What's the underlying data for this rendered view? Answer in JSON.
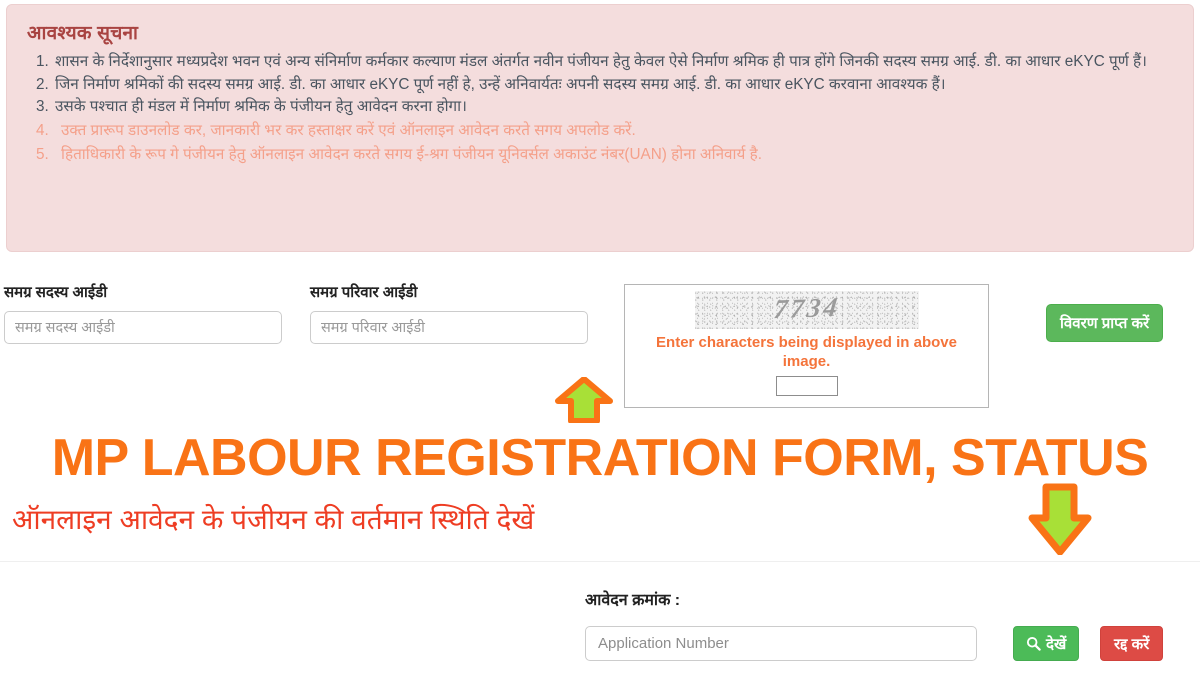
{
  "notice": {
    "title": "आवश्यक सूचना",
    "items": [
      {
        "text": "शासन के निर्देशानुसार मध्यप्रदेश भवन एवं अन्य संनिर्माण कर्मकार कल्याण मंडल अंतर्गत नवीन पंजीयन हेतु केवल ऐसे निर्माण श्रमिक ही पात्र होंगे जिनकी सदस्य समग्र आई. डी. का आधार eKYC पूर्ण हैं।",
        "style": "normal"
      },
      {
        "text": "जिन निर्माण श्रमिकों की सदस्य समग्र आई. डी. का आधार eKYC पूर्ण नहीं हे, उन्हें अनिवार्यतः अपनी सदस्य समग्र आई. डी. का आधार eKYC करवाना आवश्यक हैं।",
        "style": "normal"
      },
      {
        "text": "उसके पश्चात ही मंडल में निर्माण श्रमिक के पंजीयन हेतु आवेदन करना होगा।",
        "style": "normal"
      },
      {
        "text": "उक्त प्रारूप डाउनलोड कर, जानकारी भर कर हस्ताक्षर करें एवं ऑनलाइन आवेदन करते सगय अपलोड करें.",
        "style": "faded"
      },
      {
        "text": "हिताधिकारी के रूप गे पंजीयन हेतु ऑनलाइन आवेदन करते सगय ई-श्रग पंजीयन यूनिवर्सल अकाउंट नंबर(UAN) होना अनिवार्य है.",
        "style": "faded"
      }
    ],
    "colors": {
      "background": "#f4dddd",
      "title": "#a94442",
      "body": "#4a5560",
      "faded": "#f4a08a"
    }
  },
  "form": {
    "member_id": {
      "label": "समग्र सदस्य आईडी",
      "placeholder": "समग्र सदस्य आईडी",
      "value": ""
    },
    "family_id": {
      "label": "समग्र परिवार आईडी",
      "placeholder": "समग्र परिवार आईडी",
      "value": ""
    },
    "captcha": {
      "code": "7734",
      "hint": "Enter characters being displayed in above image.",
      "input_value": "",
      "hint_color": "#f4743b"
    },
    "get_details_button": {
      "label": "विवरण प्राप्त करें",
      "color": "#5cb85c"
    }
  },
  "arrows": {
    "up": {
      "name": "up-arrow",
      "fill": "#a8e037",
      "stroke": "#f97316"
    },
    "down": {
      "name": "down-arrow",
      "fill": "#a8e037",
      "stroke": "#f97316"
    }
  },
  "headings": {
    "main_title": "MP LABOUR REGISTRATION FORM, STATUS",
    "main_title_color": "#f97316",
    "sub_title": "ऑनलाइन आवेदन के पंजीयन की वर्तमान स्थिति देखें",
    "sub_title_color": "#ee3d23"
  },
  "status_lookup": {
    "label": "आवेदन क्रमांक :",
    "placeholder": "Application Number",
    "value": "",
    "view_button": {
      "label": "देखें",
      "icon": "search-icon",
      "color": "#4cbb58"
    },
    "cancel_button": {
      "label": "रद्द करें",
      "color": "#dd4b45"
    }
  }
}
